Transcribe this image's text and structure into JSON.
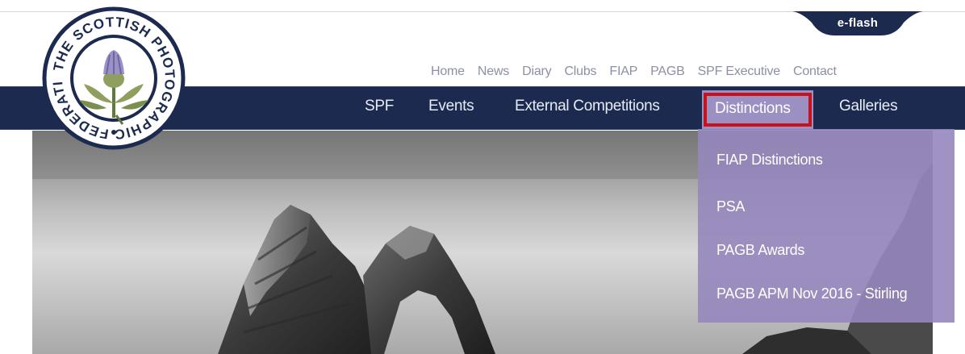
{
  "logo": {
    "text": "THE SCOTTISH PHOTOGRAPHIC FEDERATION",
    "alt": "The Scottish Photographic Federation emblem"
  },
  "eflash": {
    "label": "e-flash"
  },
  "top_nav": {
    "items": [
      "Home",
      "News",
      "Diary",
      "Clubs",
      "FIAP",
      "PAGB",
      "SPF Executive",
      "Contact"
    ]
  },
  "main_nav": {
    "items": [
      {
        "label": "SPF"
      },
      {
        "label": "Events"
      },
      {
        "label": "External Competitions"
      },
      {
        "label": "Distinctions",
        "active": true
      },
      {
        "label": "Galleries"
      }
    ]
  },
  "dropdown": {
    "items": [
      "FIAP Distinctions",
      "PSA",
      "PAGB Awards",
      "PAGB APM Nov 2016 - Stirling"
    ]
  },
  "colors": {
    "navbar": "#1b2a4e",
    "dropdown": "#9686bc",
    "highlight": "#c6121c",
    "top_nav_text": "#8c8fa6"
  }
}
